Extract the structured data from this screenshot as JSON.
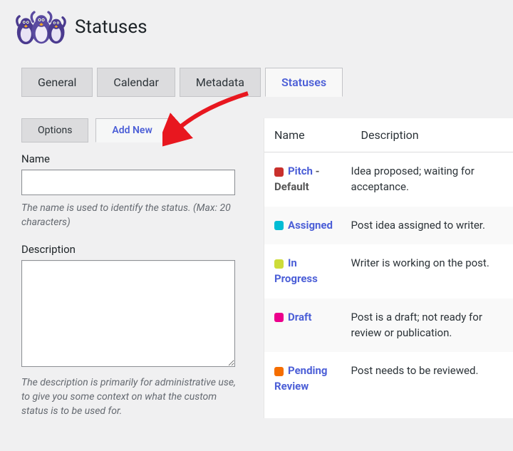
{
  "header": {
    "title": "Statuses"
  },
  "main_tabs": [
    {
      "label": "General"
    },
    {
      "label": "Calendar"
    },
    {
      "label": "Metadata"
    },
    {
      "label": "Statuses"
    }
  ],
  "sub_tabs": {
    "options": "Options",
    "add_new": "Add New"
  },
  "form": {
    "name_label": "Name",
    "name_help": "The name is used to identify the status. (Max: 20 characters)",
    "desc_label": "Description",
    "desc_help": "The description is primarily for administrative use, to give you some context on what the custom status is to be used for."
  },
  "table": {
    "col_name": "Name",
    "col_desc": "Description",
    "rows": [
      {
        "color": "#c9302c",
        "name": "Pitch",
        "default_suffix": " - Default",
        "desc": "Idea proposed; waiting for acceptance."
      },
      {
        "color": "#00bcd4",
        "name": "Assigned",
        "default_suffix": "",
        "desc": "Post idea assigned to writer."
      },
      {
        "color": "#cddc39",
        "name": "In Progress",
        "default_suffix": "",
        "desc": "Writer is working on the post."
      },
      {
        "color": "#ec008c",
        "name": "Draft",
        "default_suffix": "",
        "desc": "Post is a draft; not ready for review or publication."
      },
      {
        "color": "#f56e00",
        "name": "Pending Review",
        "default_suffix": "",
        "desc": "Post needs to be reviewed."
      }
    ]
  }
}
